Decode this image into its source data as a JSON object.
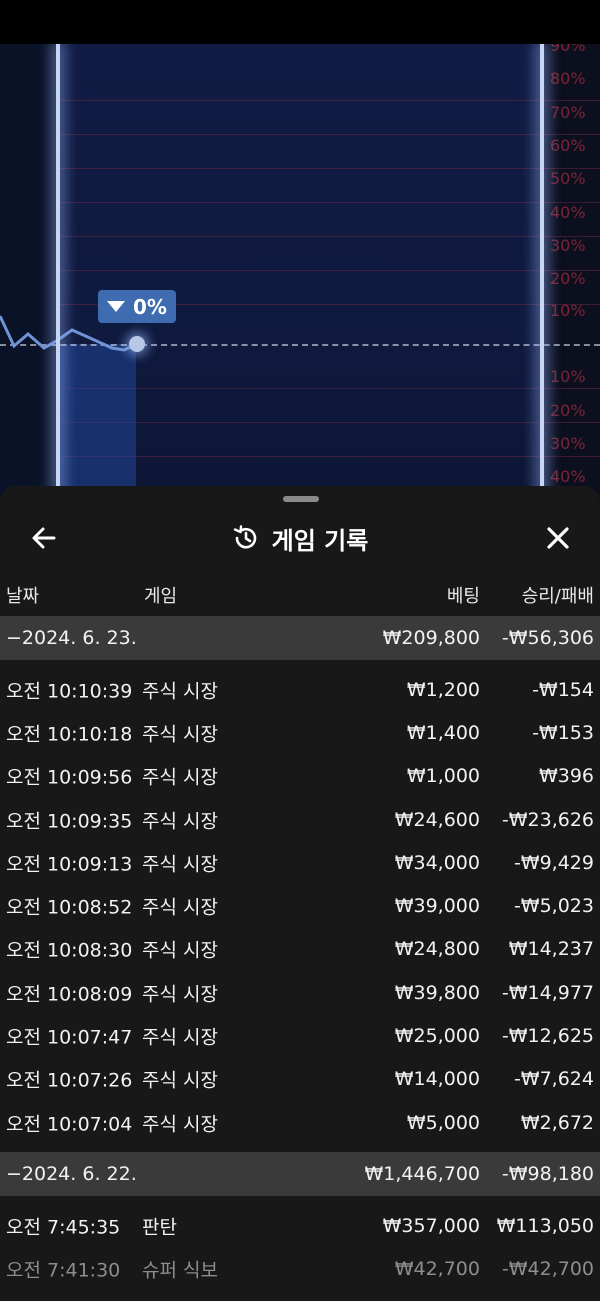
{
  "chart": {
    "axis_labels": [
      "90%",
      "80%",
      "70%",
      "60%",
      "50%",
      "40%",
      "30%",
      "20%",
      "10%",
      "10%",
      "20%",
      "30%",
      "40%"
    ],
    "indicator": {
      "label": "0%",
      "direction": "down"
    }
  },
  "sheet": {
    "title": "게임 기록",
    "columns": {
      "date": "날짜",
      "game": "게임",
      "bet": "베팅",
      "winloss": "승리/패배"
    },
    "groups": [
      {
        "date": "−2024. 6. 23.",
        "bet_total": "₩209,800",
        "winloss_total": "-₩56,306",
        "rows": [
          {
            "time": "오전 10:10:39",
            "game": "주식 시장",
            "bet": "₩1,200",
            "winloss": "-₩154"
          },
          {
            "time": "오전 10:10:18",
            "game": "주식 시장",
            "bet": "₩1,400",
            "winloss": "-₩153"
          },
          {
            "time": "오전 10:09:56",
            "game": "주식 시장",
            "bet": "₩1,000",
            "winloss": "₩396"
          },
          {
            "time": "오전 10:09:35",
            "game": "주식 시장",
            "bet": "₩24,600",
            "winloss": "-₩23,626"
          },
          {
            "time": "오전 10:09:13",
            "game": "주식 시장",
            "bet": "₩34,000",
            "winloss": "-₩9,429"
          },
          {
            "time": "오전 10:08:52",
            "game": "주식 시장",
            "bet": "₩39,000",
            "winloss": "-₩5,023"
          },
          {
            "time": "오전 10:08:30",
            "game": "주식 시장",
            "bet": "₩24,800",
            "winloss": "₩14,237"
          },
          {
            "time": "오전 10:08:09",
            "game": "주식 시장",
            "bet": "₩39,800",
            "winloss": "-₩14,977"
          },
          {
            "time": "오전 10:07:47",
            "game": "주식 시장",
            "bet": "₩25,000",
            "winloss": "-₩12,625"
          },
          {
            "time": "오전 10:07:26",
            "game": "주식 시장",
            "bet": "₩14,000",
            "winloss": "-₩7,624"
          },
          {
            "time": "오전 10:07:04",
            "game": "주식 시장",
            "bet": "₩5,000",
            "winloss": "₩2,672"
          }
        ]
      },
      {
        "date": "−2024. 6. 22.",
        "bet_total": "₩1,446,700",
        "winloss_total": "-₩98,180",
        "rows": [
          {
            "time": "오전 7:45:35",
            "game": "판탄",
            "bet": "₩357,000",
            "winloss": "₩113,050"
          },
          {
            "time": "오전 7:41:30",
            "game": "슈퍼 식보",
            "bet": "₩42,700",
            "winloss": "-₩42,700"
          }
        ]
      }
    ]
  }
}
